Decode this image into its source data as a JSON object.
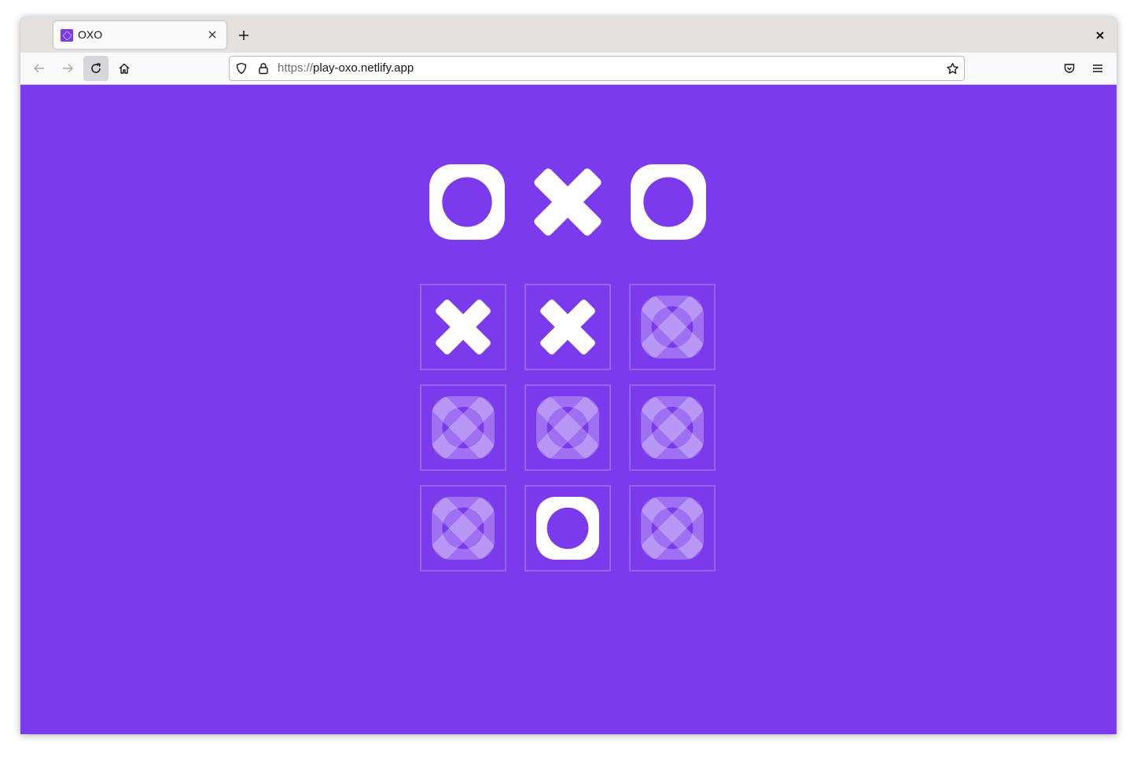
{
  "browser": {
    "tab": {
      "title": "OXO",
      "favicon": "oxo-favicon"
    },
    "url": {
      "scheme": "https://",
      "host": "play-oxo.netlify.app"
    },
    "icons": {
      "back": "back-arrow-icon",
      "forward": "forward-arrow-icon",
      "reload": "reload-icon",
      "home": "home-icon",
      "shield": "shield-icon",
      "lock": "lock-icon",
      "bookmark": "star-icon",
      "pocket": "pocket-icon",
      "menu": "hamburger-menu-icon",
      "new_tab": "plus-icon",
      "close_tab": "close-icon",
      "close_window": "close-icon"
    }
  },
  "game": {
    "logo": [
      "O",
      "X",
      "O"
    ],
    "board": [
      [
        "X",
        "X",
        ""
      ],
      [
        "",
        "",
        ""
      ],
      [
        "",
        "O",
        ""
      ]
    ],
    "empty_marker": "empty-cell-placeholder-icon"
  },
  "colors": {
    "background": "#7b3aec",
    "mark": "#ffffff",
    "empty_cell": "#ffffff"
  }
}
